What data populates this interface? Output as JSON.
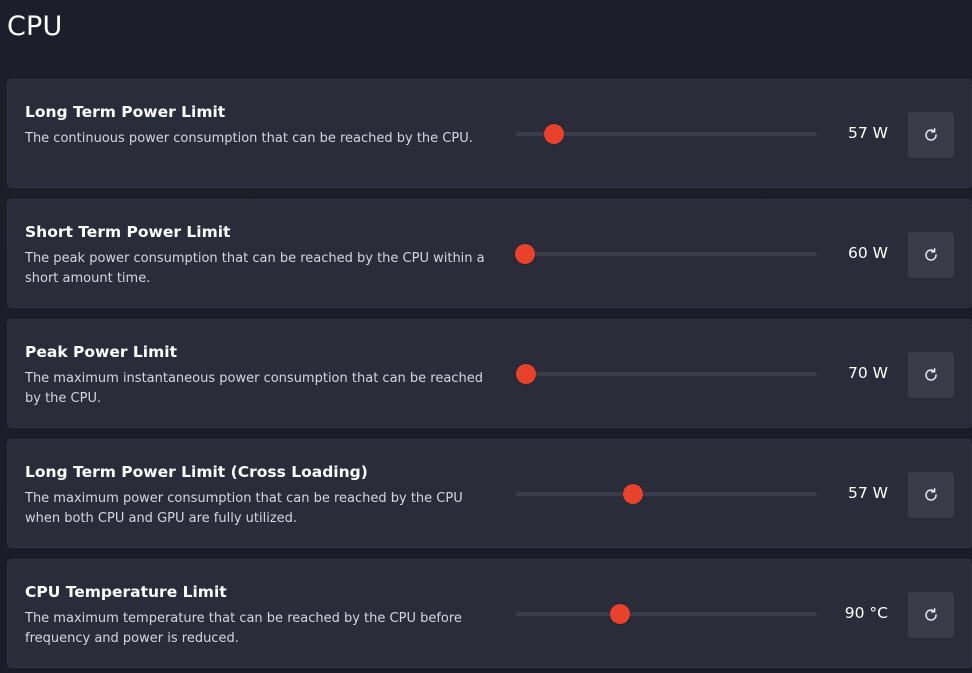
{
  "section": {
    "title": "CPU"
  },
  "colors": {
    "accent": "#e8412c",
    "card": "#2a2c3a",
    "background": "#1b1d28"
  },
  "settings": [
    {
      "title": "Long Term Power Limit",
      "description": "The continuous power consumption that can be reached by the CPU.",
      "value_label": "57 W",
      "slider_fraction": 0.125,
      "reset_icon": "reset-icon"
    },
    {
      "title": "Short Term Power Limit",
      "description": "The peak power consumption that can be reached by the CPU within a short amount time.",
      "value_label": "60 W",
      "slider_fraction": 0.03,
      "reset_icon": "reset-icon"
    },
    {
      "title": "Peak Power Limit",
      "description": "The maximum instantaneous power consumption that can be reached by the CPU.",
      "value_label": "70 W",
      "slider_fraction": 0.033,
      "reset_icon": "reset-icon"
    },
    {
      "title": "Long Term Power Limit (Cross Loading)",
      "description": "The maximum power consumption that can be reached by the CPU when both CPU and GPU are fully utilized.",
      "value_label": "57 W",
      "slider_fraction": 0.39,
      "reset_icon": "reset-icon"
    },
    {
      "title": "CPU Temperature Limit",
      "description": "The maximum temperature that can be reached by the CPU before frequency and power is reduced.",
      "value_label": "90 °C",
      "slider_fraction": 0.345,
      "reset_icon": "reset-icon"
    }
  ]
}
